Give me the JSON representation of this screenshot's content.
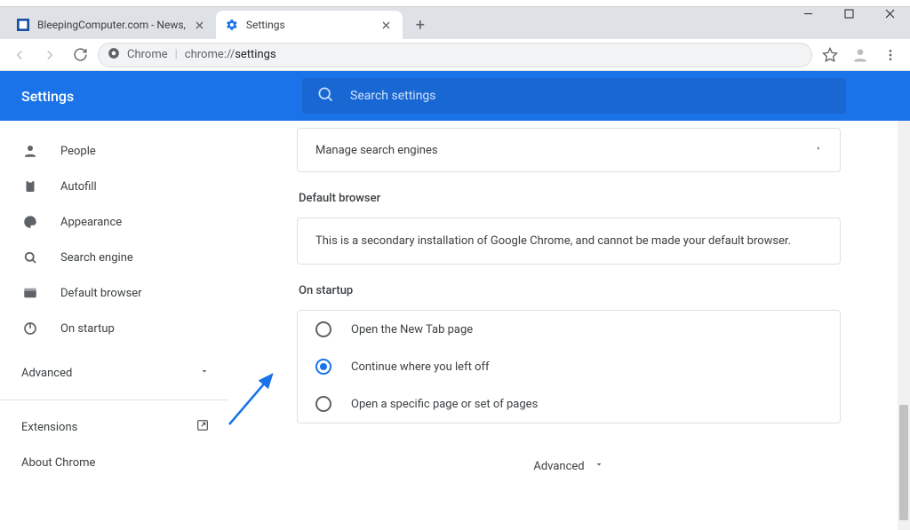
{
  "window": {
    "minimize_aria": "Minimize",
    "maximize_aria": "Maximize",
    "close_aria": "Close"
  },
  "tabs": [
    {
      "title": "BleepingComputer.com - News,",
      "favicon": "bc"
    },
    {
      "title": "Settings",
      "favicon": "gear"
    }
  ],
  "omnibox": {
    "scheme": "Chrome",
    "path_prefix": "chrome://",
    "path_highlight": "settings"
  },
  "blue_header": {
    "title": "Settings",
    "search_placeholder": "Search settings"
  },
  "sidebar": {
    "items": [
      {
        "label": "People",
        "icon": "person"
      },
      {
        "label": "Autofill",
        "icon": "autofill"
      },
      {
        "label": "Appearance",
        "icon": "palette"
      },
      {
        "label": "Search engine",
        "icon": "search"
      },
      {
        "label": "Default browser",
        "icon": "browser"
      },
      {
        "label": "On startup",
        "icon": "power"
      }
    ],
    "advanced_label": "Advanced",
    "extensions_label": "Extensions",
    "about_label": "About Chrome"
  },
  "main": {
    "manage_engines_label": "Manage search engines",
    "default_browser_title": "Default browser",
    "default_browser_msg": "This is a secondary installation of Google Chrome, and cannot be made your default browser.",
    "on_startup_title": "On startup",
    "startup_options": [
      {
        "label": "Open the New Tab page",
        "selected": false
      },
      {
        "label": "Continue where you left off",
        "selected": true
      },
      {
        "label": "Open a specific page or set of pages",
        "selected": false
      }
    ],
    "advanced_footer": "Advanced"
  }
}
